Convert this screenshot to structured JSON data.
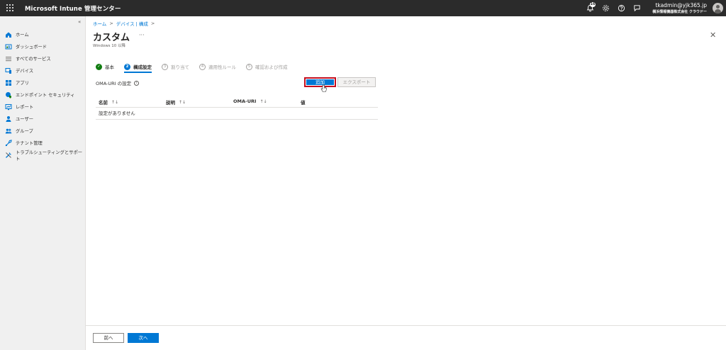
{
  "header": {
    "app_title": "Microsoft Intune 管理センター",
    "notification_count": "16",
    "account_email": "tkadmin@yjk365.jp",
    "account_org": "横浜情報機器株式会社 クラウドー"
  },
  "sidebar": {
    "collapse_glyph": "«",
    "items": [
      {
        "label": "ホーム",
        "icon": "home-icon"
      },
      {
        "label": "ダッシュボード",
        "icon": "dashboard-icon"
      },
      {
        "label": "すべてのサービス",
        "icon": "all-services-icon"
      },
      {
        "label": "デバイス",
        "icon": "devices-icon"
      },
      {
        "label": "アプリ",
        "icon": "apps-icon"
      },
      {
        "label": "エンドポイント セキュリティ",
        "icon": "endpoint-security-icon"
      },
      {
        "label": "レポート",
        "icon": "reports-icon"
      },
      {
        "label": "ユーザー",
        "icon": "users-icon"
      },
      {
        "label": "グループ",
        "icon": "groups-icon"
      },
      {
        "label": "テナント管理",
        "icon": "tenant-admin-icon"
      },
      {
        "label": "トラブルシューティングとサポート",
        "icon": "troubleshooting-icon"
      }
    ]
  },
  "breadcrumb": {
    "items": [
      "ホーム",
      "デバイス | 構成"
    ],
    "separator": ">"
  },
  "page": {
    "title": "カスタム",
    "more": "···",
    "subtitle": "Windows 10 以降",
    "close": "✕"
  },
  "wizard": {
    "steps": [
      {
        "number": "✓",
        "label": "基本",
        "state": "done"
      },
      {
        "number": "2",
        "label": "構成設定",
        "state": "active"
      },
      {
        "number": "3",
        "label": "割り当て",
        "state": "pending"
      },
      {
        "number": "4",
        "label": "適用性ルール",
        "state": "pending"
      },
      {
        "number": "5",
        "label": "確認および作成",
        "state": "pending"
      }
    ]
  },
  "oma": {
    "label": "OMA-URI の設定",
    "info": "i",
    "add_button": "追加",
    "export_button": "エクスポート"
  },
  "table": {
    "columns": [
      "名前",
      "説明",
      "OMA-URI",
      "値"
    ],
    "sort_glyph": "↑↓",
    "empty_text": "設定がありません"
  },
  "footer": {
    "prev_button": "前へ",
    "next_button": "次へ"
  },
  "colors": {
    "accent": "#0078d4",
    "success": "#107c10",
    "highlight_border": "#c50f1f",
    "topbar": "#2b2b2b"
  }
}
